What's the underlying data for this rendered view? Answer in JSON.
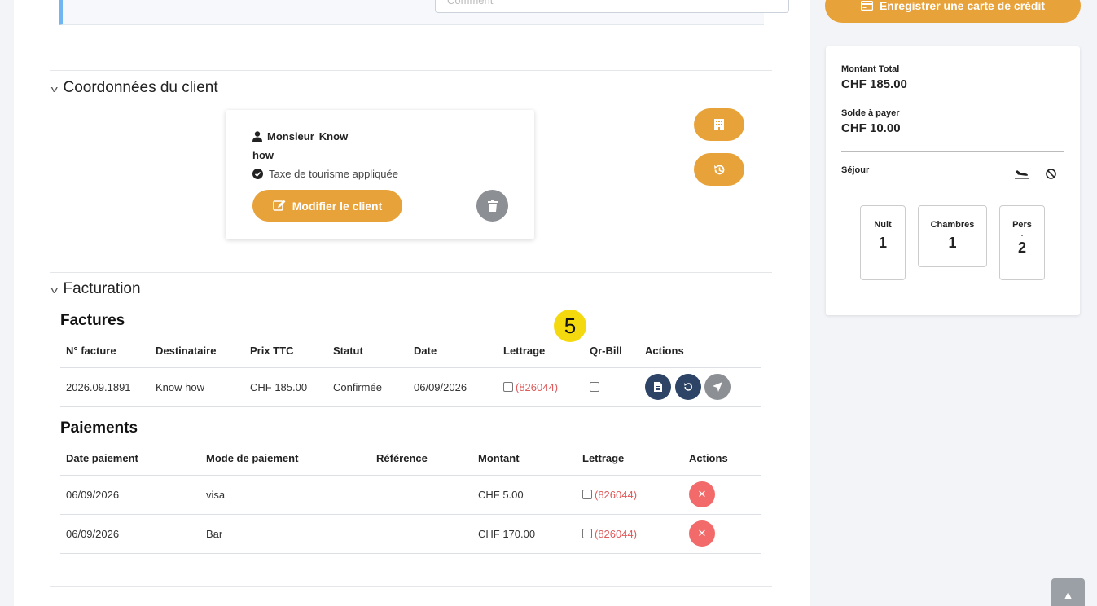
{
  "top": {
    "input_placeholder": "Comment"
  },
  "client_section": {
    "title": "Coordonnées du client",
    "salutation": "Monsieur",
    "first_name": "Know",
    "last_name": "how",
    "tax_text": "Taxe de tourisme appliquée",
    "modify_label": "Modifier le client"
  },
  "billing_section": {
    "title": "Facturation",
    "invoices": {
      "title": "Factures",
      "headers": [
        "N° facture",
        "Destinataire",
        "Prix TTC",
        "Statut",
        "Date",
        "Lettrage",
        "Qr-Bill",
        "Actions"
      ],
      "rows": [
        {
          "number": "2026.09.1891",
          "recipient": "Know how",
          "price": "CHF 185.00",
          "status": "Confirmée",
          "date": "06/09/2026",
          "lettrage": "(826044)"
        }
      ]
    },
    "payments": {
      "title": "Paiements",
      "headers": [
        "Date paiement",
        "Mode de paiement",
        "Référence",
        "Montant",
        "Lettrage",
        "Actions"
      ],
      "rows": [
        {
          "date": "06/09/2026",
          "mode": "visa",
          "reference": "",
          "amount": "CHF 5.00",
          "lettrage": "(826044)"
        },
        {
          "date": "06/09/2026",
          "mode": "Bar",
          "reference": "",
          "amount": "CHF 170.00",
          "lettrage": "(826044)"
        }
      ]
    }
  },
  "step_badge": "5",
  "sidebar": {
    "card_button": "Enregistrer une carte de crédit",
    "total_label": "Montant Total",
    "total_value": "CHF 185.00",
    "balance_label": "Solde à payer",
    "balance_value": "CHF 10.00",
    "stay_label": "Séjour",
    "nights_label": "Nuit",
    "nights_value": "1",
    "rooms_label": "Chambres",
    "rooms_value": "1",
    "persons_label": "Pers",
    "persons_sep": ".",
    "persons_value": "2"
  },
  "colors": {
    "accent": "#e8a23a",
    "dark": "#2d4466",
    "danger": "#f26a6a",
    "info": "#6fb6f2"
  }
}
